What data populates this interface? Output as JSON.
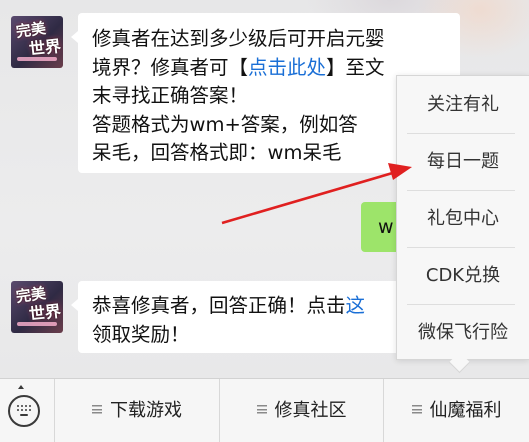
{
  "avatar": {
    "logo_line1": "完美",
    "logo_line2": "世界"
  },
  "messages": {
    "question": {
      "line1": "修真者在达到多少级后可开启元婴",
      "line2_pre": "境界？修真者可【",
      "line2_link": "点击此处",
      "line2_post": "】至文",
      "line3": "末寻找正确答案！",
      "line4": "答题格式为wm+答案，例如答",
      "line5": "呆毛，回答格式即：wm呆毛"
    },
    "user_reply": "w",
    "response": {
      "line1_pre": "恭喜修真者，回答正确！点击",
      "line1_link": "这",
      "line2": "领取奖励！"
    }
  },
  "menu": {
    "items": [
      "关注有礼",
      "每日一题",
      "礼包中心",
      "CDK兑换",
      "微保飞行险"
    ]
  },
  "bottom_bar": {
    "tabs": [
      "下载游戏",
      "修真社区",
      "仙魔福利"
    ]
  },
  "colors": {
    "link": "#1a6fd6",
    "user_bubble": "#9de46a",
    "annotation_arrow": "#e02020"
  }
}
